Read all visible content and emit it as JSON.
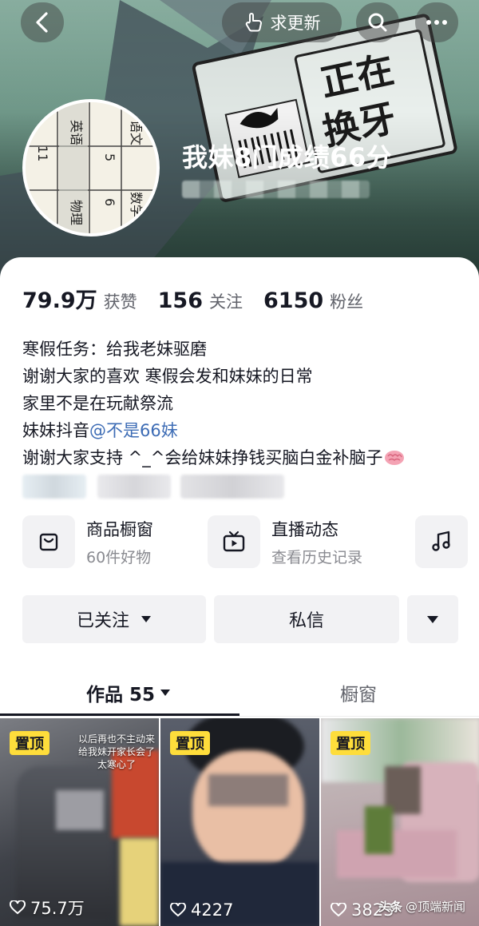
{
  "header": {
    "request_update_label": "求更新",
    "nickname": "我妹8门成绩66分",
    "art_text": [
      "正在",
      "换牙"
    ],
    "avatar_text": [
      "英语",
      "语文",
      "物理",
      "数学",
      "11",
      "5",
      "6"
    ]
  },
  "stats": [
    {
      "value": "79.9万",
      "label": "获赞"
    },
    {
      "value": "156",
      "label": "关注"
    },
    {
      "value": "6150",
      "label": "粉丝"
    }
  ],
  "bio": {
    "line1": "寒假任务：给我老妹驱磨",
    "line2": "谢谢大家的喜欢 寒假会发和妹妹的日常",
    "line3": "家里不是在玩献祭流",
    "line4_prefix": "妹妹抖音",
    "line4_link": "@不是66妹",
    "line5": "谢谢大家支持 ^_^会给妹妹挣钱买脑白金补脑子"
  },
  "shortcuts": {
    "shop_title": "商品橱窗",
    "shop_sub": "60件好物",
    "live_title": "直播动态",
    "live_sub": "查看历史记录"
  },
  "actions": {
    "followed_label": "已关注",
    "message_label": "私信"
  },
  "tabs": {
    "works_label": "作品 55",
    "window_label": "橱窗"
  },
  "videos": [
    {
      "pinned_label": "置顶",
      "likes": "75.7万",
      "caption": "以后再也不主动来给我妹开家长会了 太寒心了"
    },
    {
      "pinned_label": "置顶",
      "likes": "4227"
    },
    {
      "pinned_label": "置顶",
      "likes": "3823"
    }
  ],
  "watermark": {
    "brand": "头条",
    "handle": "@顶端新闻"
  },
  "colors": {
    "link": "#3d6cb5",
    "pin_badge": "#fedd3b",
    "button_bg": "#f2f2f4",
    "secondary_text": "#61636b"
  }
}
